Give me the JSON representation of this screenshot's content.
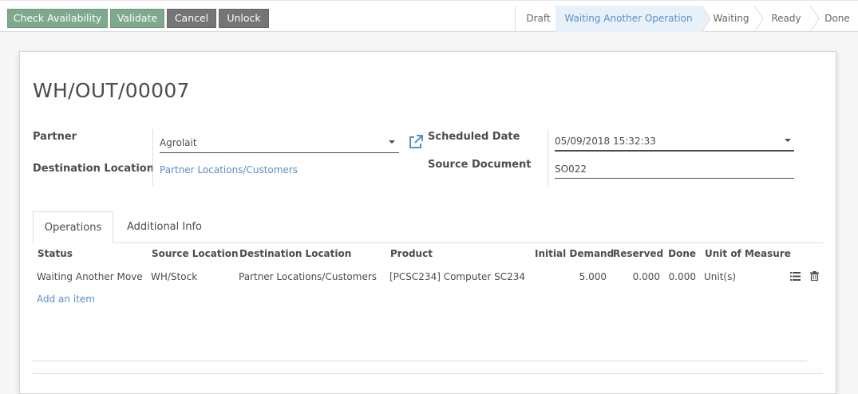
{
  "toolbar": {
    "check_availability": "Check Availability",
    "validate": "Validate",
    "cancel": "Cancel",
    "unlock": "Unlock"
  },
  "statusbar": {
    "stages": [
      "Draft",
      "Waiting Another Operation",
      "Waiting",
      "Ready",
      "Done"
    ],
    "current": "Waiting Another Operation"
  },
  "record": {
    "title": "WH/OUT/00007",
    "partner_label": "Partner",
    "partner_value": "Agrolait",
    "destination_label": "Destination Location",
    "destination_value": "Partner Locations/Customers",
    "scheduled_label": "Scheduled Date",
    "scheduled_value": "05/09/2018 15:32:33",
    "source_doc_label": "Source Document",
    "source_doc_value": "SO022"
  },
  "tabs": {
    "operations": "Operations",
    "additional_info": "Additional Info"
  },
  "table": {
    "headers": {
      "status": "Status",
      "source": "Source Location",
      "destination": "Destination Location",
      "product": "Product",
      "initial_demand": "Initial Demand",
      "reserved": "Reserved",
      "done": "Done",
      "uom": "Unit of Measure"
    },
    "rows": [
      {
        "status": "Waiting Another Move",
        "source": "WH/Stock",
        "destination": "Partner Locations/Customers",
        "product": "[PCSC234] Computer SC234",
        "initial_demand": "5.000",
        "reserved": "0.000",
        "done": "0.000",
        "uom": "Unit(s)"
      }
    ],
    "add_item": "Add an item"
  },
  "colors": {
    "primary_button": "#7fa88d",
    "secondary_button": "#757575",
    "link": "#5b8fc7",
    "current_stage_bg": "#e8f1f9"
  },
  "icons": {
    "external_link": "external-link-icon",
    "details": "list-icon",
    "delete": "trash-icon",
    "dropdown": "caret-down-icon"
  }
}
